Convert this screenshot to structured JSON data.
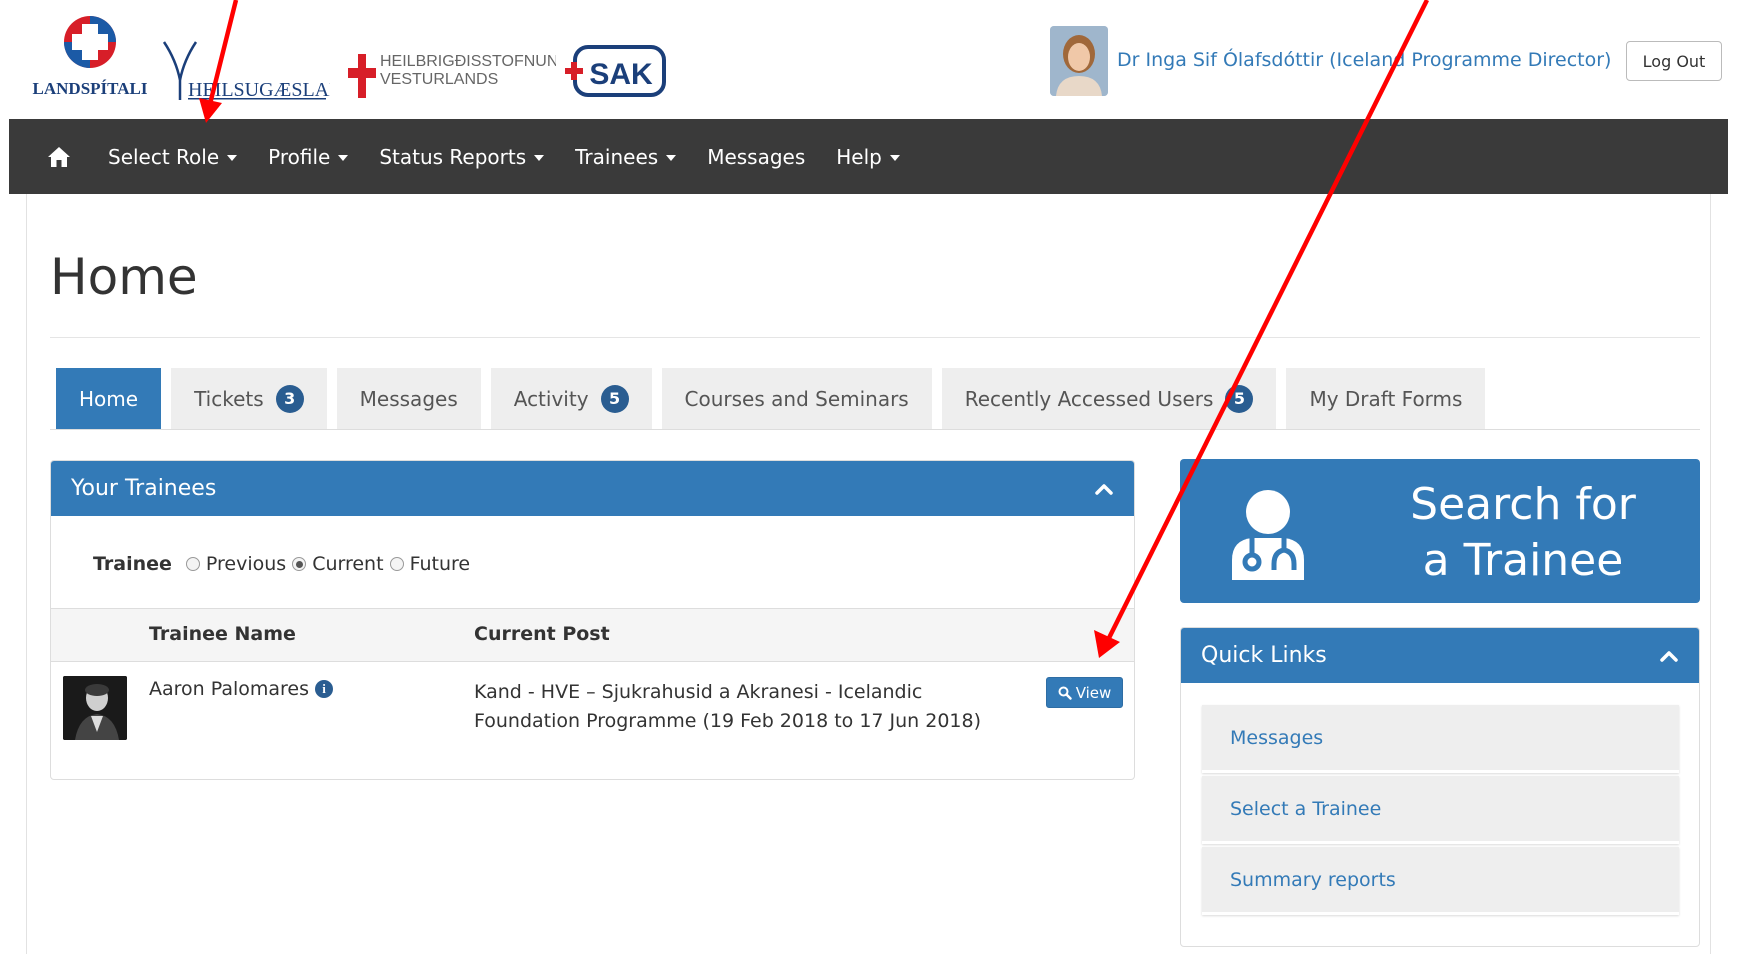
{
  "header": {
    "logos": {
      "landspitali": "LANDSPÍTALI",
      "heilsugaeslan": "HEILSUGÆSLAN",
      "hve_line1": "HEILBRIGÐISSTOFNUN",
      "hve_line2": "VESTURLANDS",
      "sak": "SAK"
    },
    "user_name": "Dr Inga Sif Ólafsdóttir (Iceland Programme Director)",
    "logout_label": "Log Out"
  },
  "navbar": {
    "items": [
      {
        "label": "Select Role",
        "dropdown": true
      },
      {
        "label": "Profile",
        "dropdown": true
      },
      {
        "label": "Status Reports",
        "dropdown": true
      },
      {
        "label": "Trainees",
        "dropdown": true
      },
      {
        "label": "Messages",
        "dropdown": false
      },
      {
        "label": "Help",
        "dropdown": true
      }
    ]
  },
  "page": {
    "title": "Home"
  },
  "tabs": [
    {
      "label": "Home",
      "active": true
    },
    {
      "label": "Tickets",
      "badge": "3"
    },
    {
      "label": "Messages"
    },
    {
      "label": "Activity",
      "badge": "5"
    },
    {
      "label": "Courses and Seminars"
    },
    {
      "label": "Recently Accessed Users",
      "badge": "5"
    },
    {
      "label": "My Draft Forms"
    }
  ],
  "trainees_panel": {
    "title": "Your Trainees",
    "filter": {
      "label": "Trainee",
      "options": [
        "Previous",
        "Current",
        "Future"
      ],
      "selected": "Current"
    },
    "columns": [
      "Trainee Name",
      "Current Post"
    ],
    "rows": [
      {
        "name": "Aaron Palomares",
        "post": "Kand - HVE – Sjukrahusid a Akranesi - Icelandic Foundation Programme (19 Feb 2018 to 17 Jun 2018)",
        "action": "View"
      }
    ]
  },
  "search_box": {
    "line1": "Search for",
    "line2": "a Trainee"
  },
  "quick_links": {
    "title": "Quick Links",
    "items": [
      "Messages",
      "Select a Trainee",
      "Summary reports"
    ]
  },
  "colors": {
    "primary": "#337ab7",
    "navbar": "#3a3a3a",
    "badge": "#2a5d91",
    "annotation_arrow": "#ff0000"
  }
}
